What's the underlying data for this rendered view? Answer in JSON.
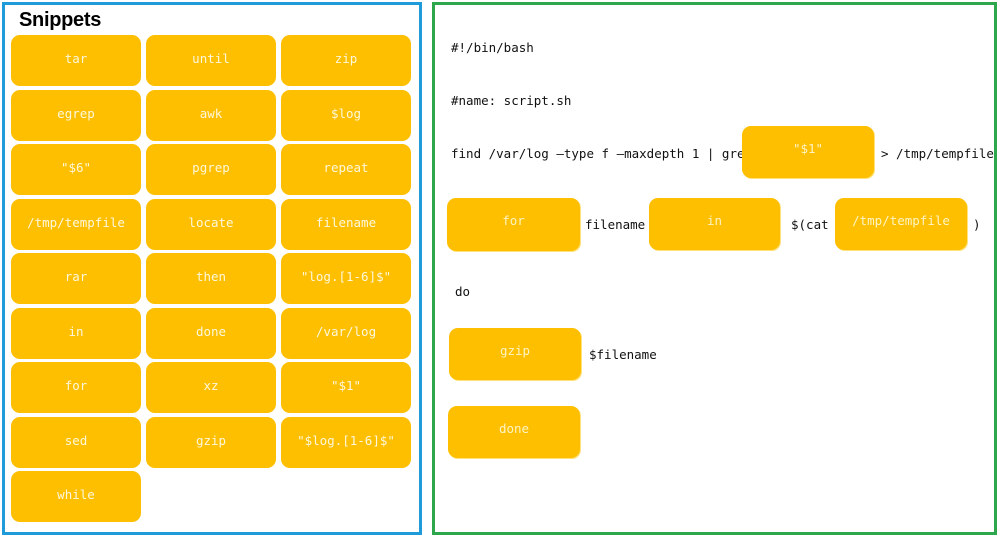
{
  "snippets_panel": {
    "title": "Snippets",
    "items": [
      "tar",
      "until",
      "zip",
      "egrep",
      "awk",
      "$log",
      "\"$6\"",
      "pgrep",
      "repeat",
      "/tmp/tempfile",
      "locate",
      "filename",
      "rar",
      "then",
      "\"log.[1-6]$\"",
      "in",
      "done",
      "/var/log",
      "for",
      "xz",
      "\"$1\"",
      "sed",
      "gzip",
      "\"$log.[1-6]$\"",
      "while"
    ]
  },
  "script_panel": {
    "line1": "#!/bin/bash",
    "line2": "#name: script.sh",
    "line3_prefix": "find /var/log –type f –maxdepth 1 | grep",
    "line3_slot": "\"$1\"",
    "line3_suffix": "> /tmp/tempfile",
    "line4_slot1": "for",
    "line4_text1": "filename",
    "line4_slot2": "in",
    "line4_text2": "$(cat",
    "line4_slot3": "/tmp/tempfile",
    "line4_text3": ")",
    "line5": "do",
    "line6_slot": "gzip",
    "line6_text": "$filename",
    "line7_slot": "done"
  },
  "colors": {
    "chip": "#fdbf00",
    "left_border": "#1e9bd8",
    "right_border": "#2ea64c"
  }
}
